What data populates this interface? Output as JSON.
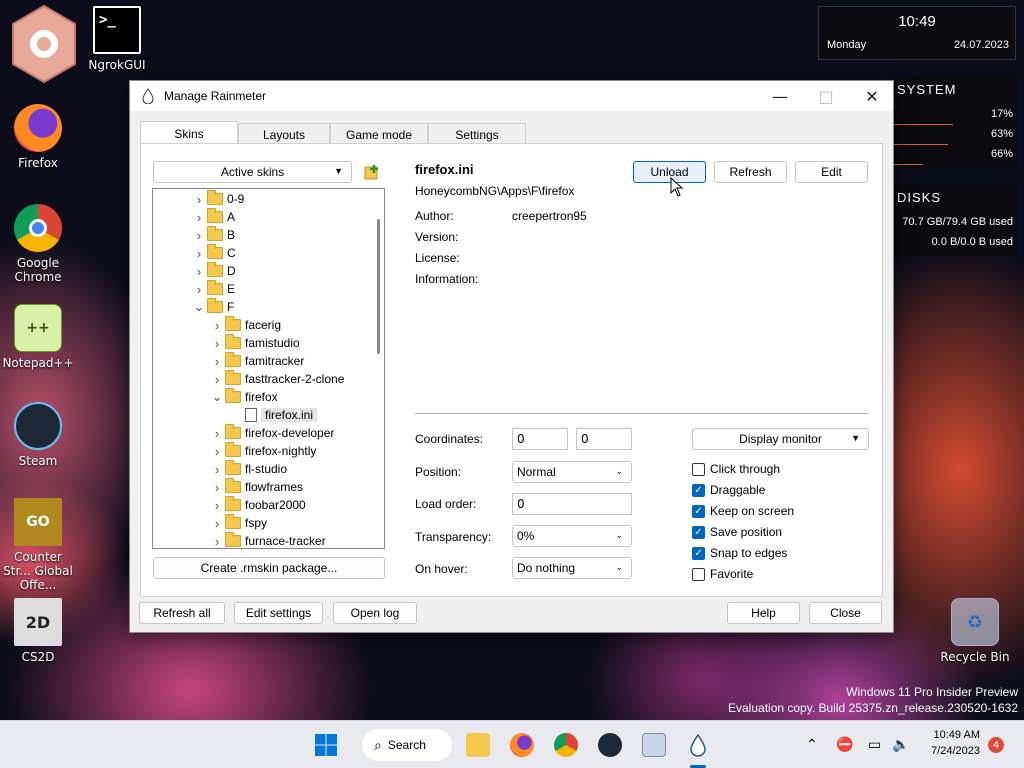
{
  "desktop": {
    "icons": [
      {
        "label": "",
        "icon": "rainmeter-hex-icon"
      },
      {
        "label": "NgrokGUI",
        "icon": "terminal-icon"
      },
      {
        "label": "Firefox",
        "icon": "firefox-icon"
      },
      {
        "label": "Google Chrome",
        "icon": "chrome-icon"
      },
      {
        "label": "Notepad++",
        "icon": "notepadpp-icon"
      },
      {
        "label": "Steam",
        "icon": "steam-icon"
      },
      {
        "label": "Counter Str... Global Offe...",
        "icon": "csgo-icon"
      },
      {
        "label": "CS2D",
        "icon": "cs2d-icon"
      },
      {
        "label": "Recycle Bin",
        "icon": "recycle-bin-icon"
      }
    ],
    "clock": {
      "time": "10:49",
      "day": "Monday",
      "date": "24.07.2023"
    },
    "system": {
      "title": "SYSTEM",
      "values": [
        "17%",
        "63%",
        "66%"
      ]
    },
    "disks": {
      "title": "DISKS",
      "values": [
        "70.7 GB/79.4 GB used",
        "0.0 B/0.0 B used"
      ]
    },
    "watermark": {
      "line1": "Windows 11 Pro Insider Preview",
      "line2": "Evaluation copy. Build 25375.zn_release.230520-1632"
    }
  },
  "window": {
    "title": "Manage Rainmeter",
    "tabs": [
      "Skins",
      "Layouts",
      "Game mode",
      "Settings"
    ],
    "active_tab": "Skins",
    "active_skins_label": "Active skins",
    "tree": [
      {
        "label": "0-9",
        "level": 1,
        "expanded": false,
        "type": "folder"
      },
      {
        "label": "A",
        "level": 1,
        "expanded": false,
        "type": "folder"
      },
      {
        "label": "B",
        "level": 1,
        "expanded": false,
        "type": "folder"
      },
      {
        "label": "C",
        "level": 1,
        "expanded": false,
        "type": "folder"
      },
      {
        "label": "D",
        "level": 1,
        "expanded": false,
        "type": "folder"
      },
      {
        "label": "E",
        "level": 1,
        "expanded": false,
        "type": "folder"
      },
      {
        "label": "F",
        "level": 1,
        "expanded": true,
        "type": "folder"
      },
      {
        "label": "facerig",
        "level": 2,
        "expanded": false,
        "type": "folder"
      },
      {
        "label": "famistudio",
        "level": 2,
        "expanded": false,
        "type": "folder"
      },
      {
        "label": "famitracker",
        "level": 2,
        "expanded": false,
        "type": "folder"
      },
      {
        "label": "fasttracker-2-clone",
        "level": 2,
        "expanded": false,
        "type": "folder"
      },
      {
        "label": "firefox",
        "level": 2,
        "expanded": true,
        "type": "folder"
      },
      {
        "label": "firefox.ini",
        "level": 3,
        "expanded": false,
        "type": "file",
        "selected": true
      },
      {
        "label": "firefox-developer",
        "level": 2,
        "expanded": false,
        "type": "folder"
      },
      {
        "label": "firefox-nightly",
        "level": 2,
        "expanded": false,
        "type": "folder"
      },
      {
        "label": "fl-studio",
        "level": 2,
        "expanded": false,
        "type": "folder"
      },
      {
        "label": "flowframes",
        "level": 2,
        "expanded": false,
        "type": "folder"
      },
      {
        "label": "foobar2000",
        "level": 2,
        "expanded": false,
        "type": "folder"
      },
      {
        "label": "fspy",
        "level": 2,
        "expanded": false,
        "type": "folder"
      },
      {
        "label": "furnace-tracker",
        "level": 2,
        "expanded": false,
        "type": "folder"
      }
    ],
    "create_package": "Create .rmskin package...",
    "skin": {
      "name": "firefox.ini",
      "path": "HoneycombNG\\Apps\\F\\firefox",
      "author_label": "Author:",
      "author": "creepertron95",
      "version_label": "Version:",
      "license_label": "License:",
      "information_label": "Information:"
    },
    "buttons": {
      "unload": "Unload",
      "refresh": "Refresh",
      "edit": "Edit"
    },
    "settings": {
      "coordinates_label": "Coordinates:",
      "coord_x": "0",
      "coord_y": "0",
      "position_label": "Position:",
      "position": "Normal",
      "load_order_label": "Load order:",
      "load_order": "0",
      "transparency_label": "Transparency:",
      "transparency": "0%",
      "on_hover_label": "On hover:",
      "on_hover": "Do nothing",
      "display_monitor": "Display monitor"
    },
    "checkboxes": [
      {
        "label": "Click through",
        "checked": false
      },
      {
        "label": "Draggable",
        "checked": true
      },
      {
        "label": "Keep on screen",
        "checked": true
      },
      {
        "label": "Save position",
        "checked": true
      },
      {
        "label": "Snap to edges",
        "checked": true
      },
      {
        "label": "Favorite",
        "checked": false
      }
    ],
    "footer": {
      "refresh_all": "Refresh all",
      "edit_settings": "Edit settings",
      "open_log": "Open log",
      "help": "Help",
      "close": "Close"
    }
  },
  "taskbar": {
    "search": "Search",
    "time": "10:49 AM",
    "date": "7/24/2023",
    "notification_count": "4"
  },
  "colors": {
    "accent": "#0067c0",
    "folder": "#f4c84a"
  }
}
